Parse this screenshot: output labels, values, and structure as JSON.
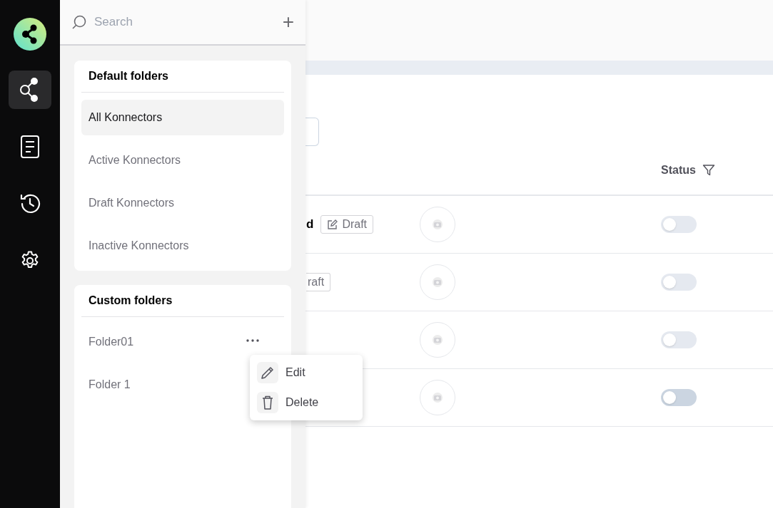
{
  "rail": {
    "items": [
      {
        "kind": "share",
        "selected": true
      },
      {
        "kind": "document",
        "selected": false
      },
      {
        "kind": "history",
        "selected": false
      },
      {
        "kind": "settings",
        "selected": false
      }
    ]
  },
  "folders_panel": {
    "search": {
      "placeholder": "Search"
    },
    "add": "+",
    "default_folders": {
      "title": "Default folders",
      "items": [
        {
          "label": "All Konnectors",
          "selected": true
        },
        {
          "label": "Active Konnectors",
          "selected": false
        },
        {
          "label": "Draft Konnectors",
          "selected": false
        },
        {
          "label": "Inactive Konnectors",
          "selected": false
        }
      ]
    },
    "custom_folders": {
      "title": "Custom folders",
      "items": [
        {
          "label": "Folder01",
          "menu_open": true
        },
        {
          "label": "Folder 1",
          "menu_open": false
        }
      ]
    },
    "menu": {
      "items": [
        {
          "kind": "edit",
          "label": "Edit"
        },
        {
          "kind": "delete",
          "label": "Delete"
        }
      ]
    }
  },
  "table": {
    "columns": [
      {
        "label": "Status"
      }
    ],
    "rows": [
      {
        "name": "d",
        "badge": "Draft",
        "badge_icon": true,
        "status_on": false,
        "highlighted": false
      },
      {
        "badge": "raft",
        "badge_icon": false,
        "status_on": false,
        "highlighted": false
      },
      {
        "status_on": false,
        "highlighted": false
      },
      {
        "status_on": false,
        "highlighted": true
      }
    ]
  }
}
